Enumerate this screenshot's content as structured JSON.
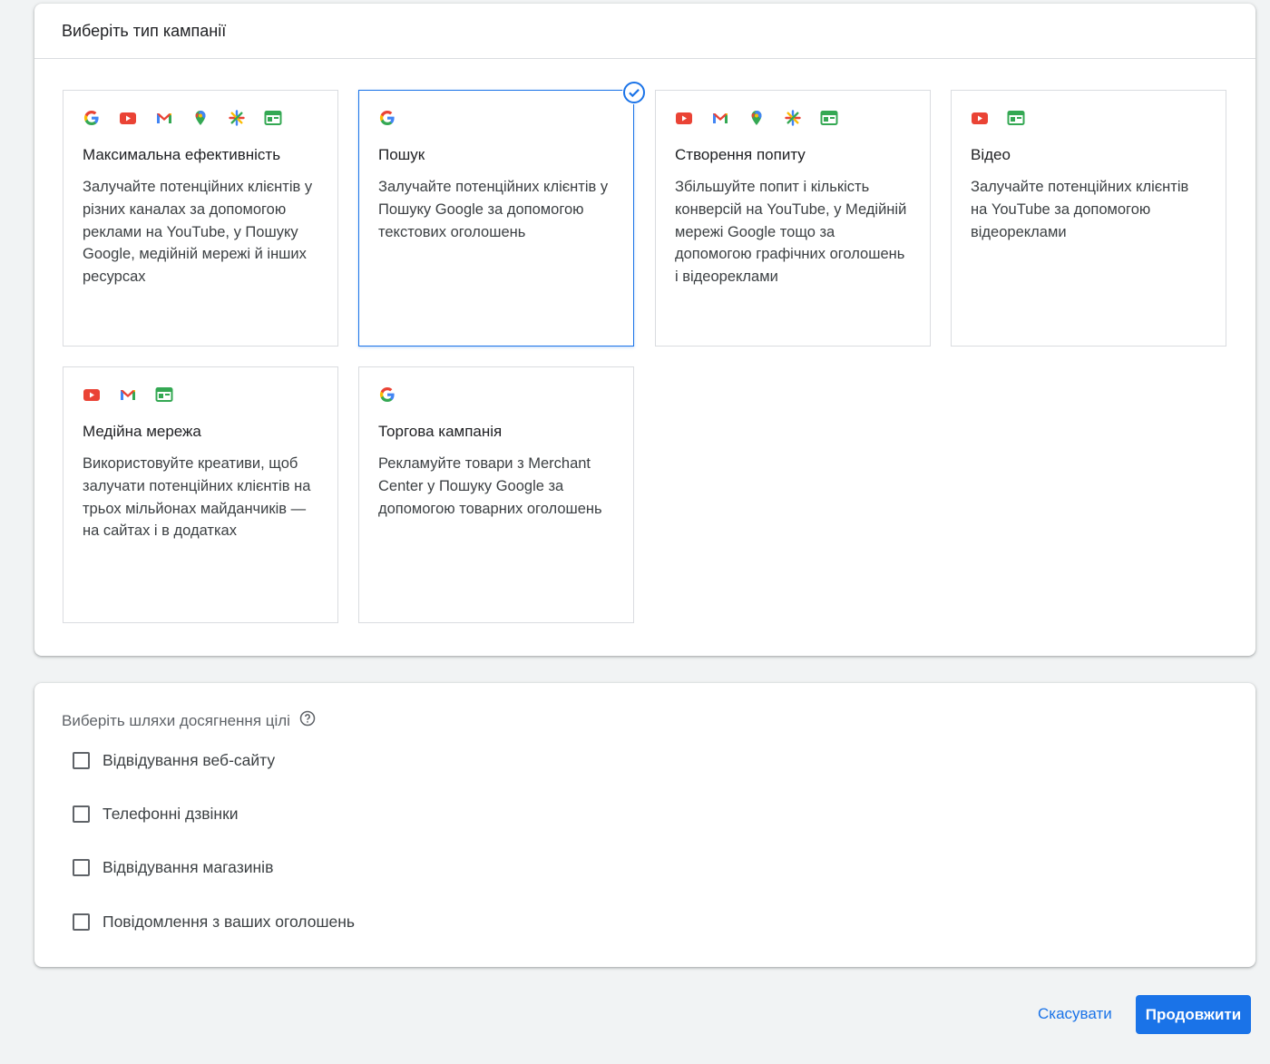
{
  "type_panel": {
    "title": "Виберіть тип кампанії",
    "cards": [
      {
        "title": "Максимальна ефективність",
        "description": "Залучайте потенційних клієнтів у різних каналах за допомогою реклами на YouTube, у Пошуку Google, медійній мережі й інших ресурсах",
        "icons": [
          "google-icon",
          "youtube-icon",
          "gmail-icon",
          "maps-icon",
          "discover-icon",
          "display-icon"
        ],
        "selected": false
      },
      {
        "title": "Пошук",
        "description": "Залучайте потенційних клієнтів у Пошуку Google за допомогою текстових оголошень",
        "icons": [
          "google-icon"
        ],
        "selected": true
      },
      {
        "title": "Створення попиту",
        "description": "Збільшуйте попит і кількість конверсій на YouTube, у Медійній мережі Google тощо за допомогою графічних оголошень і відеореклами",
        "icons": [
          "youtube-icon",
          "gmail-icon",
          "maps-icon",
          "discover-icon",
          "display-icon"
        ],
        "selected": false
      },
      {
        "title": "Відео",
        "description": "Залучайте потенційних клієнтів на YouTube за допомогою відеореклами",
        "icons": [
          "youtube-icon",
          "display-icon"
        ],
        "selected": false
      },
      {
        "title": "Медійна мережа",
        "description": "Використовуйте креативи, щоб залучати потенційних клієнтів на трьох мільйонах майданчиків — на сайтах і в додатках",
        "icons": [
          "youtube-icon",
          "gmail-icon",
          "display-icon"
        ],
        "selected": false
      },
      {
        "title": "Торгова кампанія",
        "description": "Рекламуйте товари з Merchant Center у Пошуку Google за допомогою товарних оголошень",
        "icons": [
          "google-icon"
        ],
        "selected": false
      }
    ]
  },
  "goals_panel": {
    "label": "Виберіть шляхи досягнення цілі",
    "help_icon": "help-icon",
    "options": [
      {
        "label": "Відвідування веб-сайту",
        "checked": false
      },
      {
        "label": "Телефонні дзвінки",
        "checked": false
      },
      {
        "label": "Відвідування магазинів",
        "checked": false
      },
      {
        "label": "Повідомлення з ваших оголошень",
        "checked": false
      }
    ]
  },
  "actions": {
    "cancel_label": "Скасувати",
    "continue_label": "Продовжити"
  },
  "colors": {
    "accent": "#1a73e8",
    "youtube": "#ea4335",
    "green": "#34a853",
    "yellow": "#fbbc04"
  }
}
